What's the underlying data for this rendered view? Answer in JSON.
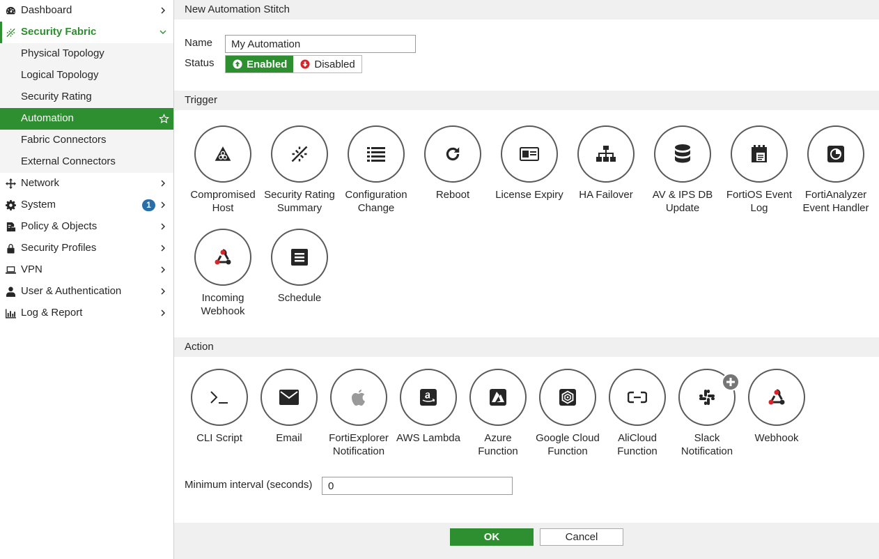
{
  "colors": {
    "accent": "#2d8f2f",
    "badge": "#2a6ea9",
    "header_bg": "#f0f0f0"
  },
  "sidebar": {
    "items": [
      {
        "label": "Dashboard",
        "icon": "dashboard-icon"
      },
      {
        "label": "Security Fabric",
        "icon": "security-fabric-icon"
      },
      {
        "label": "Physical Topology"
      },
      {
        "label": "Logical Topology"
      },
      {
        "label": "Security Rating"
      },
      {
        "label": "Automation",
        "icon": "star-icon"
      },
      {
        "label": "Fabric Connectors"
      },
      {
        "label": "External Connectors"
      },
      {
        "label": "Network",
        "icon": "network-icon"
      },
      {
        "label": "System",
        "icon": "gear-icon",
        "badge": "1"
      },
      {
        "label": "Policy & Objects",
        "icon": "policy-icon"
      },
      {
        "label": "Security Profiles",
        "icon": "lock-icon"
      },
      {
        "label": "VPN",
        "icon": "laptop-icon"
      },
      {
        "label": "User & Authentication",
        "icon": "user-icon"
      },
      {
        "label": "Log & Report",
        "icon": "chart-icon"
      }
    ]
  },
  "page": {
    "title": "New Automation Stitch"
  },
  "form": {
    "name_label": "Name",
    "name_value": "My Automation",
    "status_label": "Status",
    "status_enabled": "Enabled",
    "status_disabled": "Disabled",
    "interval_label": "Minimum interval (seconds)",
    "interval_value": "0"
  },
  "trigger": {
    "title": "Trigger",
    "items": [
      {
        "label": "Compromised\nHost",
        "icon": "biohazard-icon"
      },
      {
        "label": "Security Rating\nSummary",
        "icon": "security-fabric-icon"
      },
      {
        "label": "Configuration\nChange",
        "icon": "list-icon"
      },
      {
        "label": "Reboot",
        "icon": "reboot-icon"
      },
      {
        "label": "License Expiry",
        "icon": "id-card-icon"
      },
      {
        "label": "HA Failover",
        "icon": "sitemap-icon"
      },
      {
        "label": "AV & IPS DB\nUpdate",
        "icon": "database-icon"
      },
      {
        "label": "FortiOS Event\nLog",
        "icon": "calendar-log-icon"
      },
      {
        "label": "FortiAnalyzer\nEvent Handler",
        "icon": "analyzer-icon"
      },
      {
        "label": "Incoming\nWebhook",
        "icon": "webhook-icon"
      },
      {
        "label": "Schedule",
        "icon": "schedule-icon"
      }
    ]
  },
  "action": {
    "title": "Action",
    "items": [
      {
        "label": "CLI Script",
        "icon": "terminal-icon"
      },
      {
        "label": "Email",
        "icon": "envelope-icon"
      },
      {
        "label": "FortiExplorer\nNotification",
        "icon": "apple-icon"
      },
      {
        "label": "AWS Lambda",
        "icon": "amazon-icon"
      },
      {
        "label": "Azure\nFunction",
        "icon": "azure-icon"
      },
      {
        "label": "Google Cloud\nFunction",
        "icon": "google-cloud-icon"
      },
      {
        "label": "AliCloud\nFunction",
        "icon": "alicloud-icon"
      },
      {
        "label": "Slack\nNotification",
        "icon": "slack-icon"
      },
      {
        "label": "Webhook",
        "icon": "webhook-icon"
      }
    ]
  },
  "buttons": {
    "ok": "OK",
    "cancel": "Cancel"
  }
}
